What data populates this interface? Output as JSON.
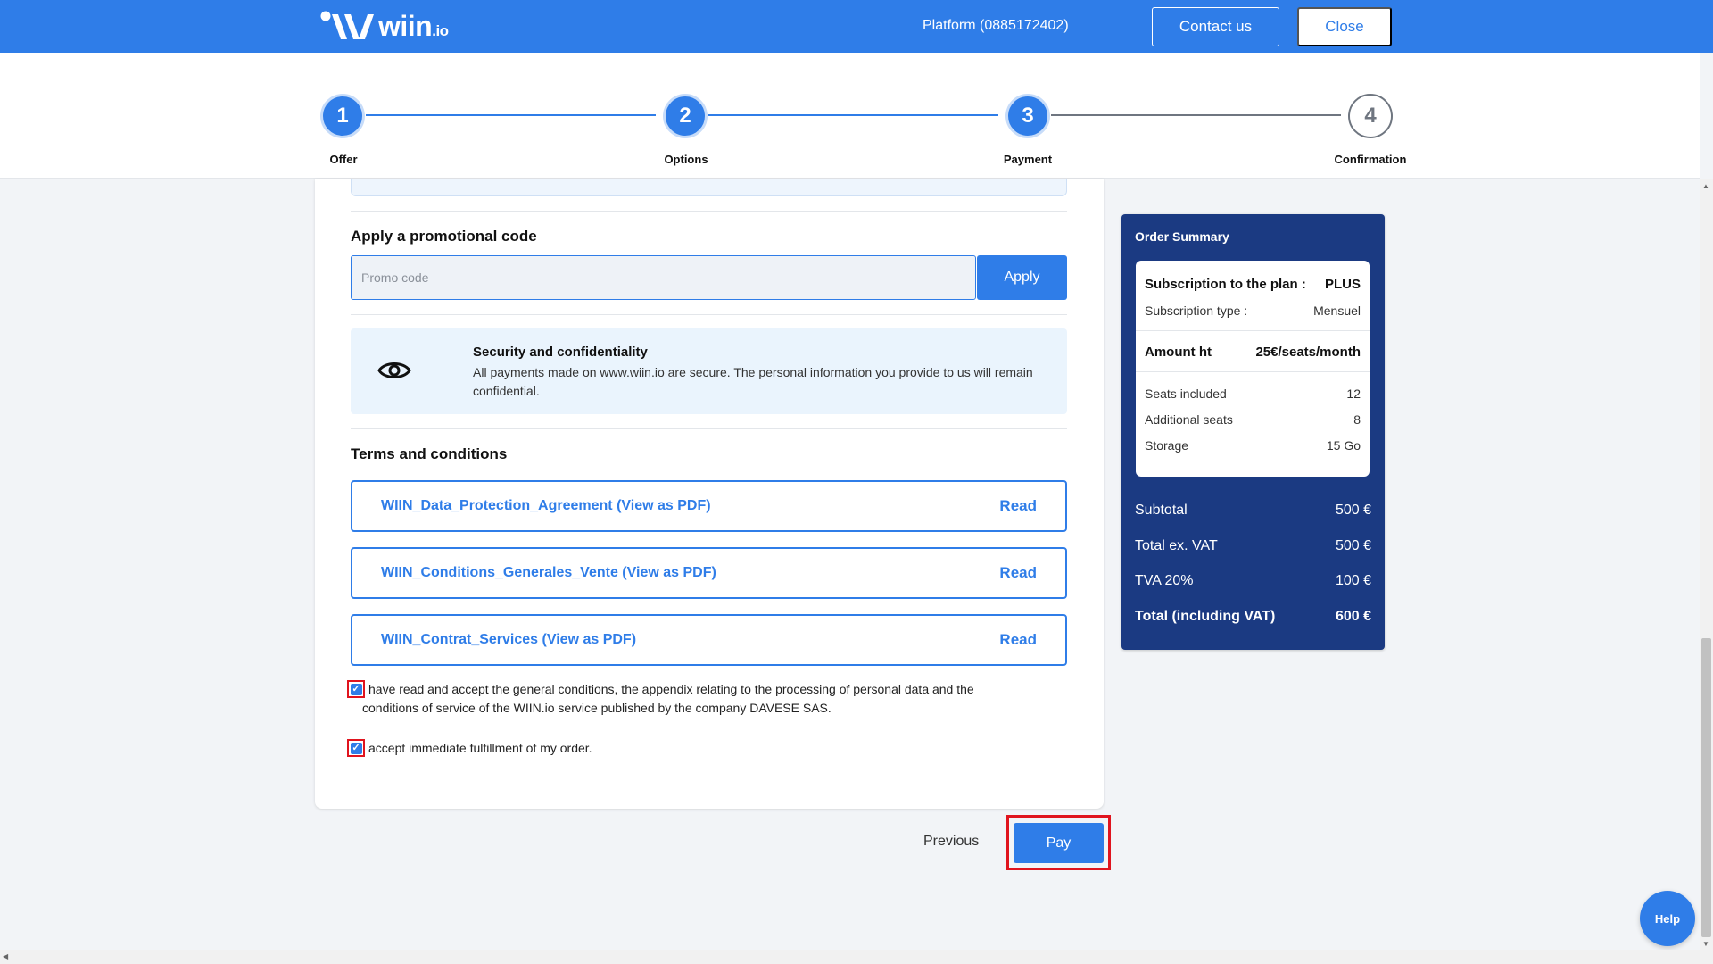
{
  "header": {
    "logo_text": "wiin",
    "logo_suffix": ".io",
    "platform": "Platform (0885172402)",
    "contact_label": "Contact us",
    "close_label": "Close"
  },
  "stepper": {
    "steps": [
      {
        "number": "1",
        "label": "Offer",
        "active": true
      },
      {
        "number": "2",
        "label": "Options",
        "active": true
      },
      {
        "number": "3",
        "label": "Payment",
        "active": true
      },
      {
        "number": "4",
        "label": "Confirmation",
        "active": false
      }
    ]
  },
  "promo": {
    "title": "Apply a promotional code",
    "placeholder": "Promo code",
    "value": "",
    "apply_label": "Apply"
  },
  "security": {
    "icon": "eye-icon",
    "title": "Security and confidentiality",
    "text": "All payments made on www.wiin.io are secure. The personal information you provide to us will remain confidential."
  },
  "terms": {
    "title": "Terms and conditions",
    "documents": [
      {
        "name": "WIIN_Data_Protection_Agreement (View as PDF)",
        "action": "Read"
      },
      {
        "name": "WIIN_Conditions_Generales_Vente (View as PDF)",
        "action": "Read"
      },
      {
        "name": "WIIN_Contrat_Services (View as PDF)",
        "action": "Read"
      }
    ],
    "checkboxes": [
      {
        "checked": true,
        "line1": "have read and accept the general conditions, the appendix relating to the processing of personal data and the",
        "line2": "conditions of service of the WIIN.io service published by the company DAVESE SAS."
      },
      {
        "checked": true,
        "line1": "accept immediate fulfillment of my order."
      }
    ]
  },
  "actions": {
    "previous_label": "Previous",
    "pay_label": "Pay"
  },
  "summary": {
    "title": "Order Summary",
    "plan_label": "Subscription to the plan :",
    "plan_value": "PLUS",
    "type_label": "Subscription type :",
    "type_value": "Mensuel",
    "amount_label": "Amount ht",
    "amount_value": "25€/seats/month",
    "seats_label": "Seats included",
    "seats_value": "12",
    "additional_label": "Additional seats",
    "additional_value": "8",
    "storage_label": "Storage",
    "storage_value": "15 Go",
    "subtotal_label": "Subtotal",
    "subtotal_value": "500 €",
    "total_ex_label": "Total ex. VAT",
    "total_ex_value": "500 €",
    "tva_label": "TVA 20%",
    "tva_value": "100 €",
    "total_label": "Total (including VAT)",
    "total_value": "600 €"
  },
  "help_label": "Help",
  "colors": {
    "brand": "#2f7de8",
    "summary_bg": "#1b3a82",
    "highlight": "#e0141e"
  }
}
